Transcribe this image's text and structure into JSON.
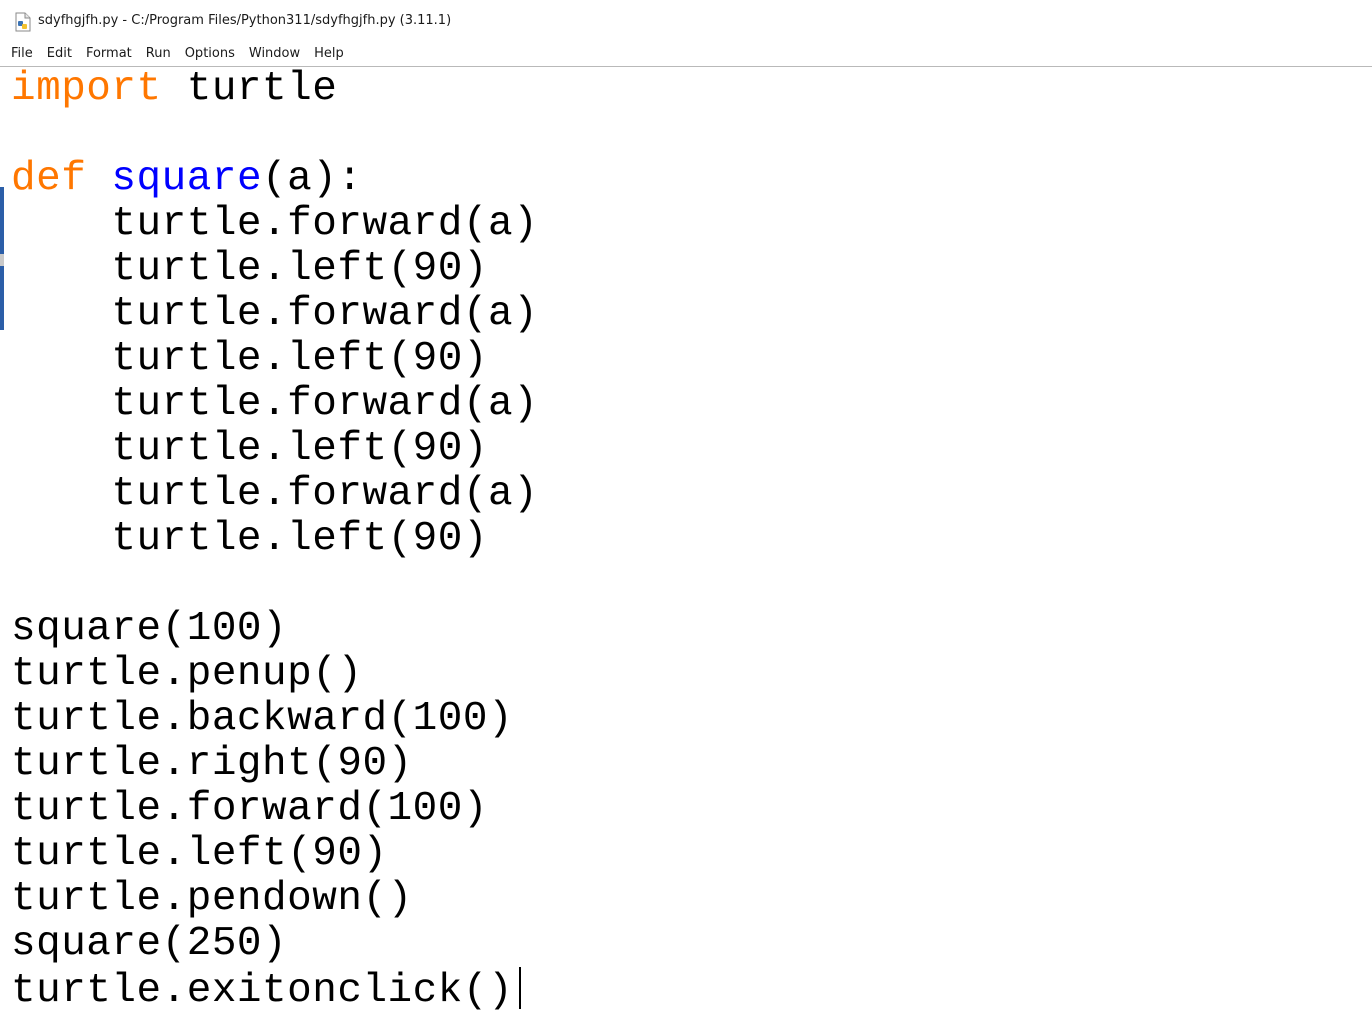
{
  "window": {
    "title": "sdyfhgjfh.py - C:/Program Files/Python311/sdyfhgjfh.py (3.11.1)",
    "icon": "python-file-icon"
  },
  "menu": {
    "file": "File",
    "edit": "Edit",
    "format": "Format",
    "run": "Run",
    "options": "Options",
    "window": "Window",
    "help": "Help"
  },
  "code": {
    "line1_kw": "import",
    "line1_rest": " turtle",
    "line3_kw": "def",
    "line3_name": "square",
    "line3_rest": "(a):",
    "line4": "    turtle.forward(a)",
    "line5": "    turtle.left(90)",
    "line6": "    turtle.forward(a)",
    "line7": "    turtle.left(90)",
    "line8": "    turtle.forward(a)",
    "line9": "    turtle.left(90)",
    "line10": "    turtle.forward(a)",
    "line11": "    turtle.left(90)",
    "line13": "square(100)",
    "line14": "turtle.penup()",
    "line15": "turtle.backward(100)",
    "line16": "turtle.right(90)",
    "line17": "turtle.forward(100)",
    "line18": "turtle.left(90)",
    "line19": "turtle.pendown()",
    "line20": "square(250)",
    "line21": "turtle.exitonclick()"
  },
  "colors": {
    "keyword": "#ff7700",
    "definition": "#0000ff",
    "text": "#000000"
  }
}
